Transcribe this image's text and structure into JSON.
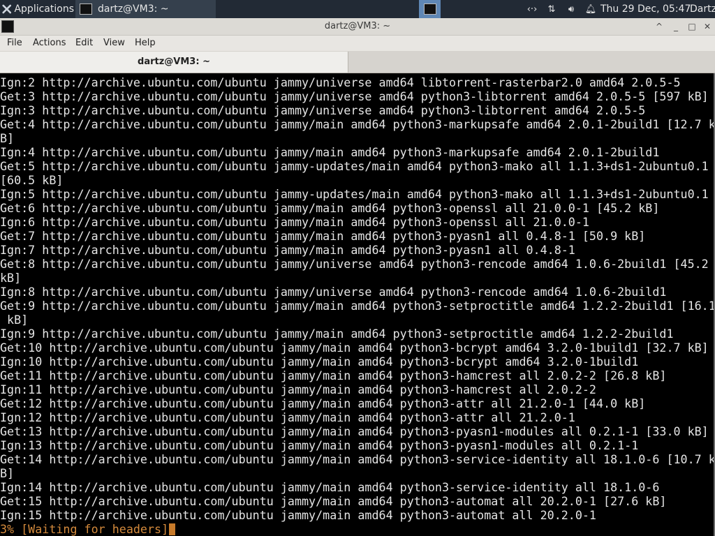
{
  "panel": {
    "applications_label": "Applications",
    "task_label": "dartz@VM3: ~",
    "clock": "Thu 29 Dec, 05:47",
    "user": "Dartz"
  },
  "window": {
    "title": "dartz@VM3: ~",
    "minimize_glyph": "_",
    "maximize_glyph": "□",
    "close_glyph": "✕",
    "shade_glyph": "^"
  },
  "menu": {
    "file": "File",
    "actions": "Actions",
    "edit": "Edit",
    "view": "View",
    "help": "Help"
  },
  "tab": {
    "label": "dartz@VM3: ~"
  },
  "terminal": {
    "lines": [
      "Ign:2 http://archive.ubuntu.com/ubuntu jammy/universe amd64 libtorrent-rasterbar2.0 amd64 2.0.5-5",
      "Get:3 http://archive.ubuntu.com/ubuntu jammy/universe amd64 python3-libtorrent amd64 2.0.5-5 [597 kB]",
      "Ign:3 http://archive.ubuntu.com/ubuntu jammy/universe amd64 python3-libtorrent amd64 2.0.5-5",
      "Get:4 http://archive.ubuntu.com/ubuntu jammy/main amd64 python3-markupsafe amd64 2.0.1-2build1 [12.7 k",
      "B]",
      "Ign:4 http://archive.ubuntu.com/ubuntu jammy/main amd64 python3-markupsafe amd64 2.0.1-2build1",
      "Get:5 http://archive.ubuntu.com/ubuntu jammy-updates/main amd64 python3-mako all 1.1.3+ds1-2ubuntu0.1",
      "[60.5 kB]",
      "Ign:5 http://archive.ubuntu.com/ubuntu jammy-updates/main amd64 python3-mako all 1.1.3+ds1-2ubuntu0.1",
      "Get:6 http://archive.ubuntu.com/ubuntu jammy/main amd64 python3-openssl all 21.0.0-1 [45.2 kB]",
      "Ign:6 http://archive.ubuntu.com/ubuntu jammy/main amd64 python3-openssl all 21.0.0-1",
      "Get:7 http://archive.ubuntu.com/ubuntu jammy/main amd64 python3-pyasn1 all 0.4.8-1 [50.9 kB]",
      "Ign:7 http://archive.ubuntu.com/ubuntu jammy/main amd64 python3-pyasn1 all 0.4.8-1",
      "Get:8 http://archive.ubuntu.com/ubuntu jammy/universe amd64 python3-rencode amd64 1.0.6-2build1 [45.2",
      "kB]",
      "Ign:8 http://archive.ubuntu.com/ubuntu jammy/universe amd64 python3-rencode amd64 1.0.6-2build1",
      "Get:9 http://archive.ubuntu.com/ubuntu jammy/main amd64 python3-setproctitle amd64 1.2.2-2build1 [16.1",
      " kB]",
      "Ign:9 http://archive.ubuntu.com/ubuntu jammy/main amd64 python3-setproctitle amd64 1.2.2-2build1",
      "Get:10 http://archive.ubuntu.com/ubuntu jammy/main amd64 python3-bcrypt amd64 3.2.0-1build1 [32.7 kB]",
      "Ign:10 http://archive.ubuntu.com/ubuntu jammy/main amd64 python3-bcrypt amd64 3.2.0-1build1",
      "Get:11 http://archive.ubuntu.com/ubuntu jammy/main amd64 python3-hamcrest all 2.0.2-2 [26.8 kB]",
      "Ign:11 http://archive.ubuntu.com/ubuntu jammy/main amd64 python3-hamcrest all 2.0.2-2",
      "Get:12 http://archive.ubuntu.com/ubuntu jammy/main amd64 python3-attr all 21.2.0-1 [44.0 kB]",
      "Ign:12 http://archive.ubuntu.com/ubuntu jammy/main amd64 python3-attr all 21.2.0-1",
      "Get:13 http://archive.ubuntu.com/ubuntu jammy/main amd64 python3-pyasn1-modules all 0.2.1-1 [33.0 kB]",
      "Ign:13 http://archive.ubuntu.com/ubuntu jammy/main amd64 python3-pyasn1-modules all 0.2.1-1",
      "Get:14 http://archive.ubuntu.com/ubuntu jammy/main amd64 python3-service-identity all 18.1.0-6 [10.7 k",
      "B]",
      "Ign:14 http://archive.ubuntu.com/ubuntu jammy/main amd64 python3-service-identity all 18.1.0-6",
      "Get:15 http://archive.ubuntu.com/ubuntu jammy/main amd64 python3-automat all 20.2.0-1 [27.6 kB]",
      "Ign:15 http://archive.ubuntu.com/ubuntu jammy/main amd64 python3-automat all 20.2.0-1"
    ],
    "status_line": "3% [Waiting for headers]"
  },
  "colors": {
    "terminal_bg": "#000000",
    "terminal_fg": "#e5e5e5",
    "status_fg": "#d48a3c",
    "cursor": "#c77a2a",
    "panel_bg": "#222a35"
  }
}
